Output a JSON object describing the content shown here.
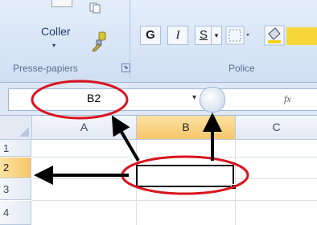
{
  "ribbon": {
    "clipboard": {
      "paste_label": "Coller",
      "paste_dropdown": "▾",
      "group_label": "Presse-papiers",
      "launcher": "⬊"
    },
    "font": {
      "bold_label": "G",
      "italic_label": "I",
      "underline_label": "S",
      "dropdown": "▾",
      "group_label": "Police"
    }
  },
  "formula_bar": {
    "name_box_value": "B2",
    "name_box_arrow": "▾",
    "fx_label": "fx"
  },
  "sheet": {
    "columns": [
      "A",
      "B",
      "C"
    ],
    "rows": [
      "1",
      "2",
      "3",
      "4"
    ],
    "active_column": "B",
    "active_row": "2"
  },
  "annotations": {
    "highlight_color": "#d9141f",
    "arrow_color": "#000000"
  }
}
